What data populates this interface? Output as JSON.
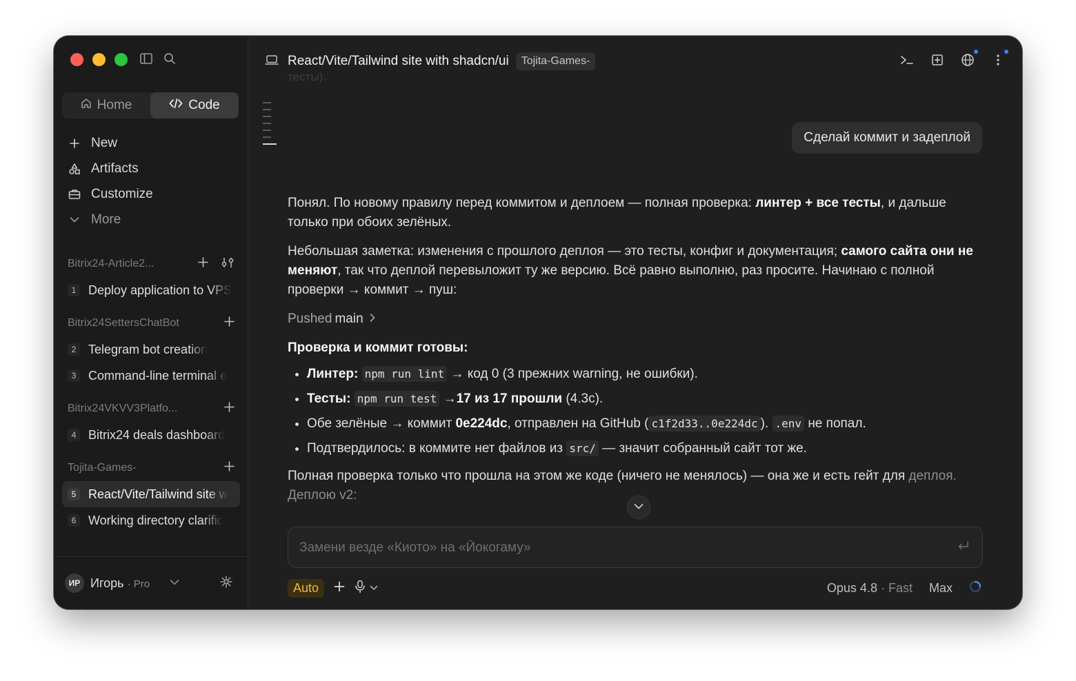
{
  "sidebar": {
    "tabs": {
      "home": "Home",
      "code": "Code"
    },
    "nav": {
      "new": "New",
      "artifacts": "Artifacts",
      "customize": "Customize",
      "more": "More"
    },
    "projects": [
      {
        "name": "Bitrix24-Article2...",
        "threads": [
          {
            "num": "1",
            "title": "Deploy application to VPS"
          }
        ]
      },
      {
        "name": "Bitrix24SettersChatBot",
        "threads": [
          {
            "num": "2",
            "title": "Telegram bot creation"
          },
          {
            "num": "3",
            "title": "Command-line terminal e"
          }
        ]
      },
      {
        "name": "Bitrix24VKVV3Platfo...",
        "threads": [
          {
            "num": "4",
            "title": "Bitrix24 deals dashboard"
          }
        ]
      },
      {
        "name": "Tojita-Games-",
        "threads": [
          {
            "num": "5",
            "title": "React/Vite/Tailwind site w"
          },
          {
            "num": "6",
            "title": "Working directory clarific"
          }
        ]
      }
    ],
    "user": {
      "initials": "ИР",
      "name": "Игорь",
      "plan": "· Pro"
    }
  },
  "header": {
    "title": "React/Vite/Tailwind site with shadcn/ui",
    "badge": "Tojita-Games-"
  },
  "chat": {
    "ghost_text": "тесты).",
    "user_message": "Сделай коммит и задеплой",
    "p1_a": "Понял. По новому правилу перед коммитом и деплоем — полная проверка: ",
    "p1_b": "линтер + все тесты",
    "p1_c": ", и дальше только при обоих зелёных.",
    "p2_a": "Небольшая заметка: изменения с прошлого деплоя — это тесты, конфиг и документация; ",
    "p2_b": "самого сайта они не меняют",
    "p2_c": ", так что деплой перевыложит ту же версию. Всё равно выполню, раз просите. Начинаю с полной проверки → коммит → пуш:",
    "pushed_prefix": "Pushed",
    "pushed_branch": "main",
    "check_heading": "Проверка и коммит готовы:",
    "bullets": {
      "b1_label": "Линтер:",
      "b1_code": "npm run lint",
      "b1_text": "→ код 0 (3 прежних warning, не ошибки).",
      "b2_label": "Тесты:",
      "b2_code": "npm run test",
      "b2_arrow": "→",
      "b2_bold": "17 из 17 прошли",
      "b2_text": "(4.3с).",
      "b3_a": "Обе зелёные → коммит",
      "b3_hash": "0e224dc",
      "b3_b": ", отправлен на GitHub (",
      "b3_range": "c1f2d33..0e224dc",
      "b3_c": ").",
      "b3_env": ".env",
      "b3_d": "не попал.",
      "b4_a": "Подтвердилось: в коммите нет файлов из",
      "b4_code": "src/",
      "b4_b": "— значит собранный сайт тот же."
    },
    "p3": "Полная проверка только что прошла на этом же коде (ничего не менялось) — она же и есть гейт для",
    "p3_fade": "деплоя. Деплою v2:"
  },
  "composer": {
    "placeholder": "Замени везде «Киото» на «Йокогаму»",
    "mode": "Auto",
    "model": "Opus 4.8",
    "speed": "· Fast",
    "effort": "Max"
  }
}
